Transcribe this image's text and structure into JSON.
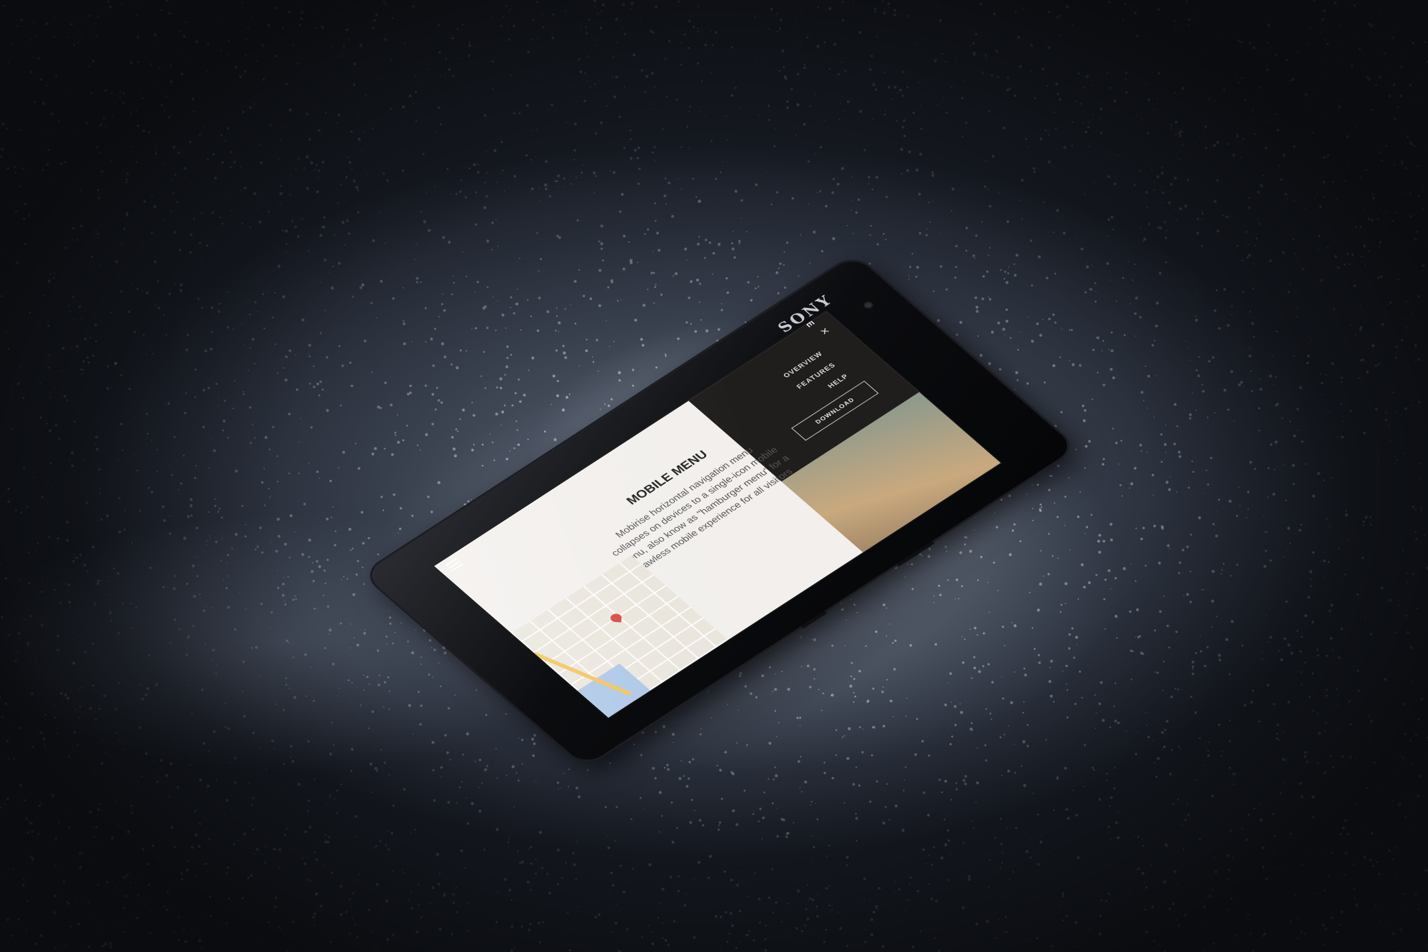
{
  "phone": {
    "brand": "SONY"
  },
  "screen": {
    "logo_text": "MOBIRISE",
    "menu": {
      "items": [
        "OVERVIEW",
        "FEATURES",
        "HELP"
      ],
      "download_label": "DOWNLOAD",
      "close_glyph": "×"
    },
    "section": {
      "title": "MOBILE MENU",
      "body": "Mobirise horizontal navigation menu collapses on devices to a single-icon mobile menu, also know as \"hamburger menu\" for a flawless mobile experience for all visitors"
    }
  },
  "colors": {
    "menu_bg": "#201d1d",
    "page_bg": "#f2efec",
    "ground": "#3a414f"
  },
  "icons": [
    "hamburger-menu-icon",
    "close-icon",
    "map-pin-icon",
    "front-camera-icon"
  ]
}
